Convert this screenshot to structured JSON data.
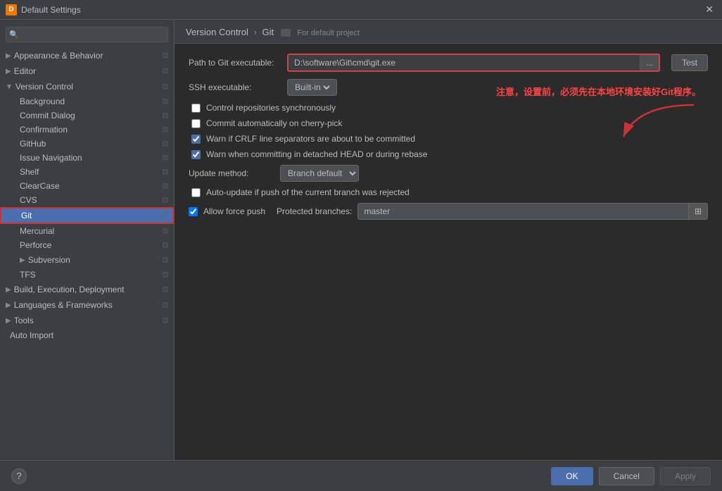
{
  "titleBar": {
    "title": "Default Settings",
    "closeLabel": "✕"
  },
  "sidebar": {
    "searchPlaceholder": "🔍",
    "items": [
      {
        "id": "appearance",
        "label": "Appearance & Behavior",
        "type": "group",
        "expanded": false,
        "indent": 0
      },
      {
        "id": "editor",
        "label": "Editor",
        "type": "group",
        "expanded": false,
        "indent": 0
      },
      {
        "id": "version-control",
        "label": "Version Control",
        "type": "group",
        "expanded": true,
        "indent": 0
      },
      {
        "id": "background",
        "label": "Background",
        "type": "child",
        "indent": 1
      },
      {
        "id": "commit-dialog",
        "label": "Commit Dialog",
        "type": "child",
        "indent": 1
      },
      {
        "id": "confirmation",
        "label": "Confirmation",
        "type": "child",
        "indent": 1
      },
      {
        "id": "github",
        "label": "GitHub",
        "type": "child",
        "indent": 1
      },
      {
        "id": "issue-navigation",
        "label": "Issue Navigation",
        "type": "child",
        "indent": 1
      },
      {
        "id": "shelf",
        "label": "Shelf",
        "type": "child",
        "indent": 1
      },
      {
        "id": "clearcase",
        "label": "ClearCase",
        "type": "child",
        "indent": 1
      },
      {
        "id": "cvs",
        "label": "CVS",
        "type": "child",
        "indent": 1
      },
      {
        "id": "git",
        "label": "Git",
        "type": "child",
        "indent": 1,
        "selected": true
      },
      {
        "id": "mercurial",
        "label": "Mercurial",
        "type": "child",
        "indent": 1
      },
      {
        "id": "perforce",
        "label": "Perforce",
        "type": "child",
        "indent": 1
      },
      {
        "id": "subversion",
        "label": "Subversion",
        "type": "group",
        "expanded": false,
        "indent": 1
      },
      {
        "id": "tfs",
        "label": "TFS",
        "type": "child",
        "indent": 1
      },
      {
        "id": "build-execution",
        "label": "Build, Execution, Deployment",
        "type": "group",
        "expanded": false,
        "indent": 0
      },
      {
        "id": "languages",
        "label": "Languages & Frameworks",
        "type": "group",
        "expanded": false,
        "indent": 0
      },
      {
        "id": "tools",
        "label": "Tools",
        "type": "group",
        "expanded": false,
        "indent": 0
      },
      {
        "id": "auto-import",
        "label": "Auto Import",
        "type": "item",
        "indent": 0
      }
    ]
  },
  "panel": {
    "breadcrumb1": "Version Control",
    "breadcrumb2": "Git",
    "forDefaultProject": "For default project",
    "pathLabel": "Path to Git executable:",
    "pathValue": "D:\\software\\Git\\cmd\\git.exe",
    "pathBtnLabel": "...",
    "testBtnLabel": "Test",
    "sshLabel": "SSH executable:",
    "sshValue": "Built-in",
    "checkboxes": [
      {
        "id": "ctrl-sync",
        "label": "Control repositories synchronously",
        "checked": false
      },
      {
        "id": "auto-commit",
        "label": "Commit automatically on cherry-pick",
        "checked": false
      },
      {
        "id": "warn-crlf",
        "label": "Warn if CRLF line separators are about to be committed",
        "checked": true
      },
      {
        "id": "warn-detach",
        "label": "Warn when committing in detached HEAD or during rebase",
        "checked": true
      }
    ],
    "updateMethodLabel": "Update method:",
    "updateMethodValue": "Branch default",
    "autoUpdateLabel": "Auto-update if push of the current branch was rejected",
    "autoUpdateChecked": false,
    "allowForcePushLabel": "Allow force push",
    "allowForcePushChecked": true,
    "protectedBranchesLabel": "Protected branches:",
    "protectedBranchesValue": "master"
  },
  "annotation": {
    "text": "注意，设置前，必须先在本地环境安装好Git程序。",
    "arrowColor": "#cc3333"
  },
  "footer": {
    "helpLabel": "?",
    "okLabel": "OK",
    "cancelLabel": "Cancel",
    "applyLabel": "Apply"
  }
}
